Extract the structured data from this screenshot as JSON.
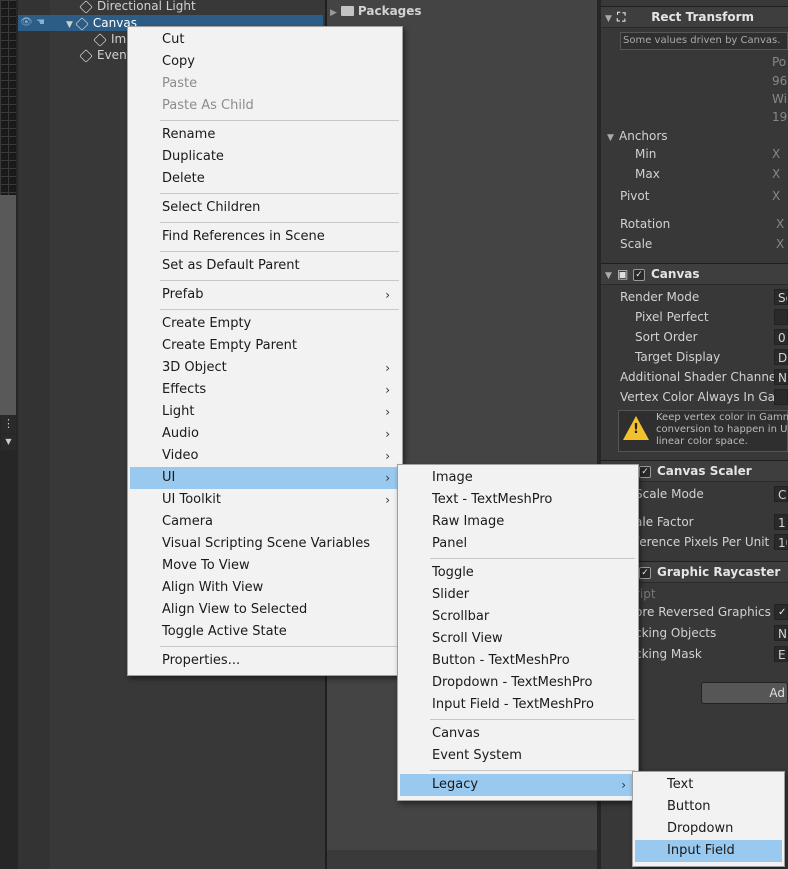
{
  "hierarchy": {
    "items": [
      {
        "label": "Directional Light",
        "icon": "cube-icon"
      },
      {
        "label": "Canvas",
        "icon": "cube-icon"
      },
      {
        "label": "Ima",
        "icon": "cube-icon"
      },
      {
        "label": "Event",
        "icon": "cube-icon"
      }
    ]
  },
  "project": {
    "packages_label": "Packages"
  },
  "inspector": {
    "rect_transform": {
      "title": "Rect Transform",
      "note": "Some values driven by Canvas.",
      "pos_label": "Po",
      "pos_value": "96",
      "width_label": "Wi",
      "width_value": "19",
      "anchors": "Anchors",
      "min": "Min",
      "max": "Max",
      "pivot": "Pivot",
      "rotation": "Rotation",
      "scale": "Scale",
      "x": "X"
    },
    "canvas": {
      "title": "Canvas",
      "render_mode": "Render Mode",
      "render_mode_value": "Sc",
      "pixel_perfect": "Pixel Perfect",
      "sort_order": "Sort Order",
      "sort_order_value": "0",
      "target_display": "Target Display",
      "target_display_value": "D",
      "additional_shader": "Additional Shader Channels",
      "additional_shader_value": "N",
      "vertex_color": "Vertex Color Always In Gam",
      "warning": [
        "Keep vertex color in Gamm",
        "conversion to happen in UI",
        "linear color space."
      ]
    },
    "canvas_scaler": {
      "title": "Canvas Scaler",
      "scale_mode": "Scale Mode",
      "scale_mode_value": "C",
      "scale_factor": "ale Factor",
      "scale_factor_value": "1",
      "ref_pixels": "ference Pixels Per Unit",
      "ref_pixels_value": "10"
    },
    "graphic_raycaster": {
      "title": "Graphic Raycaster",
      "script": "ript",
      "ignore_reversed": "ore Reversed Graphics",
      "blocking_objects": "cking Objects",
      "blocking_objects_value": "N",
      "blocking_mask": "cking Mask",
      "blocking_mask_value": "E"
    },
    "add_button": "Ad"
  },
  "context_menu": {
    "groups": [
      [
        {
          "label": "Cut"
        },
        {
          "label": "Copy"
        },
        {
          "label": "Paste",
          "disabled": true
        },
        {
          "label": "Paste As Child",
          "disabled": true
        }
      ],
      [
        {
          "label": "Rename"
        },
        {
          "label": "Duplicate"
        },
        {
          "label": "Delete"
        }
      ],
      [
        {
          "label": "Select Children"
        }
      ],
      [
        {
          "label": "Find References in Scene"
        }
      ],
      [
        {
          "label": "Set as Default Parent"
        }
      ],
      [
        {
          "label": "Prefab",
          "submenu": true
        }
      ],
      [
        {
          "label": "Create Empty"
        },
        {
          "label": "Create Empty Parent"
        },
        {
          "label": "3D Object",
          "submenu": true
        },
        {
          "label": "Effects",
          "submenu": true
        },
        {
          "label": "Light",
          "submenu": true
        },
        {
          "label": "Audio",
          "submenu": true
        },
        {
          "label": "Video",
          "submenu": true
        },
        {
          "label": "UI",
          "submenu": true,
          "highlighted": true
        },
        {
          "label": "UI Toolkit",
          "submenu": true
        },
        {
          "label": "Camera"
        },
        {
          "label": "Visual Scripting Scene Variables"
        },
        {
          "label": "Move To View"
        },
        {
          "label": "Align With View"
        },
        {
          "label": "Align View to Selected"
        },
        {
          "label": "Toggle Active State"
        }
      ],
      [
        {
          "label": "Properties..."
        }
      ]
    ]
  },
  "ui_submenu": {
    "groups": [
      [
        {
          "label": "Image"
        },
        {
          "label": "Text - TextMeshPro"
        },
        {
          "label": "Raw Image"
        },
        {
          "label": "Panel"
        }
      ],
      [
        {
          "label": "Toggle"
        },
        {
          "label": "Slider"
        },
        {
          "label": "Scrollbar"
        },
        {
          "label": "Scroll View"
        },
        {
          "label": "Button - TextMeshPro"
        },
        {
          "label": "Dropdown - TextMeshPro"
        },
        {
          "label": "Input Field - TextMeshPro"
        }
      ],
      [
        {
          "label": "Canvas"
        },
        {
          "label": "Event System"
        }
      ],
      [
        {
          "label": "Legacy",
          "submenu": true,
          "highlighted": true
        }
      ]
    ]
  },
  "legacy_submenu": {
    "items": [
      {
        "label": "Text"
      },
      {
        "label": "Button"
      },
      {
        "label": "Dropdown"
      },
      {
        "label": "Input Field",
        "highlighted": true
      }
    ]
  },
  "colors": {
    "highlight": "#99c9ef",
    "selection": "#2c5d87",
    "menu_bg": "#f2f2f2"
  }
}
